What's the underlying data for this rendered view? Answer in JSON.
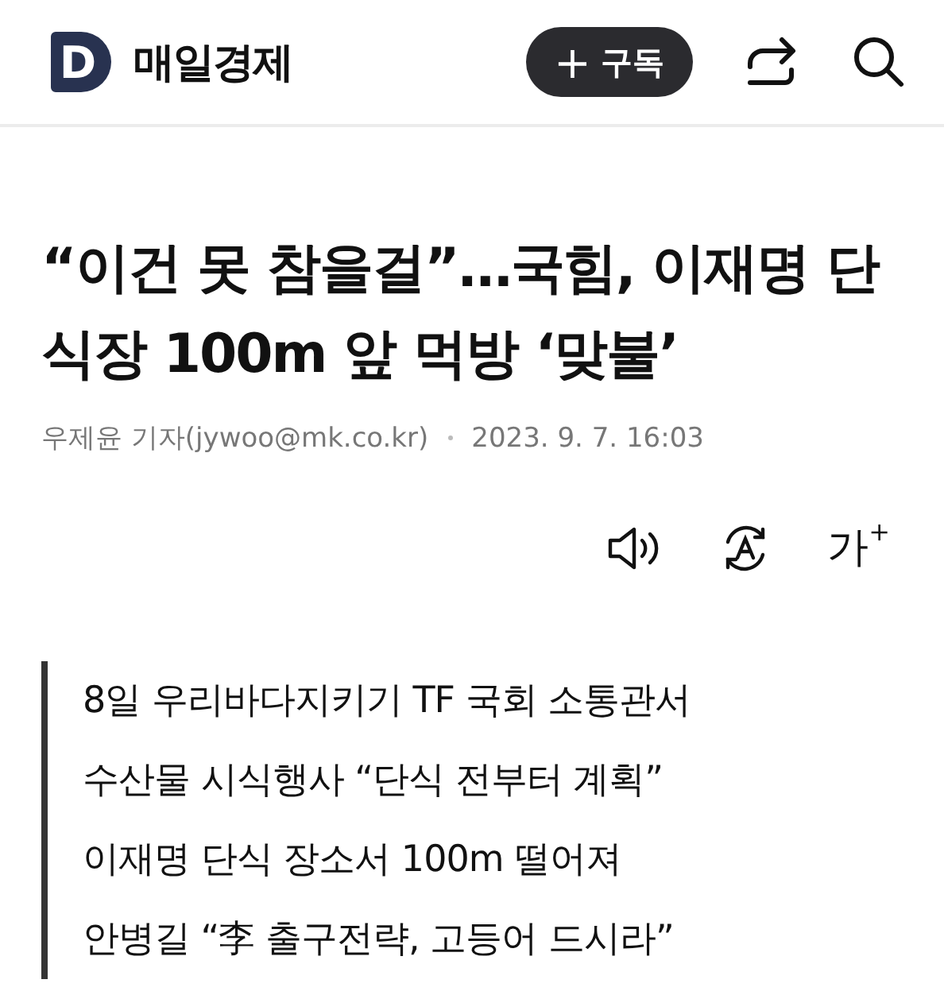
{
  "header": {
    "logo_letter": "D",
    "brand": "매일경제",
    "subscribe_button": {
      "icon": "+",
      "label": "구독"
    }
  },
  "article": {
    "title": "“이건 못 참을걸”…국힘, 이재명 단식장 100m 앞 먹방 ‘맞불’",
    "byline": "우제윤 기자(jywoo@mk.co.kr)",
    "date": "2023. 9. 7. 16:03",
    "font_size_button": {
      "label": "가",
      "sup": "+"
    }
  },
  "summary": [
    "8일 우리바다지키기 TF 국회 소통관서",
    "수산물 시식행사 “단식 전부터 계획”",
    "이재명 단식 장소서 100m 떨어져",
    "안병길 “李 출구전략, 고등어 드시라”"
  ]
}
